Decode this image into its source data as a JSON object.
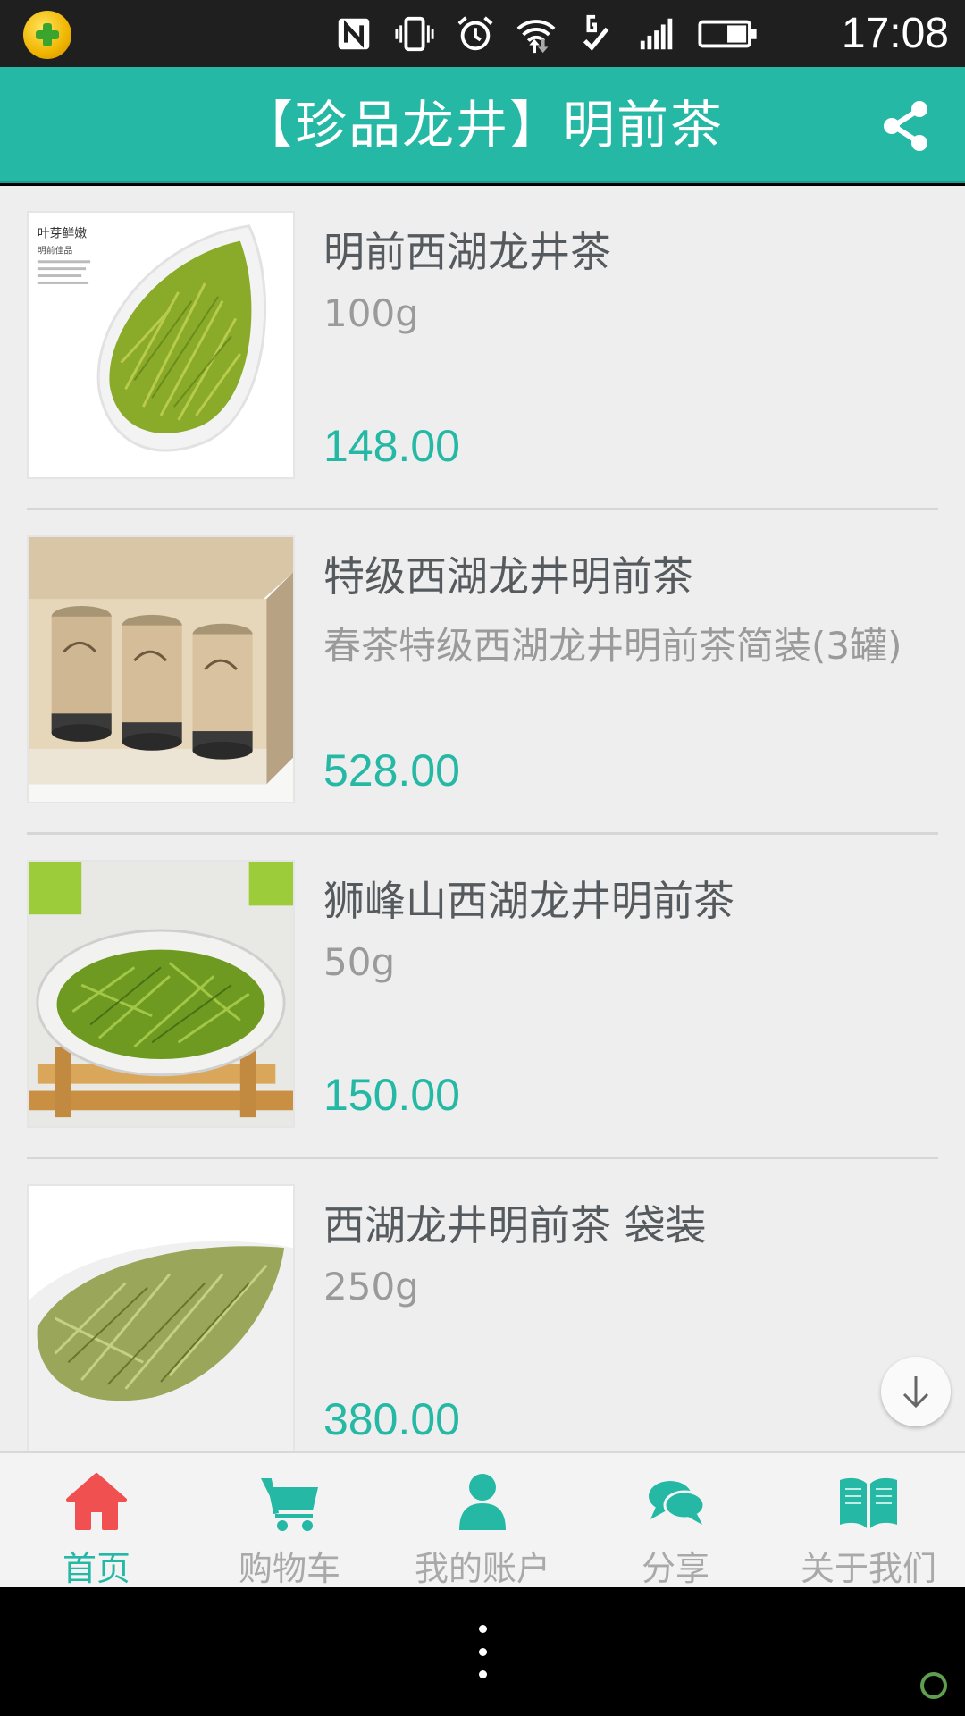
{
  "status_bar": {
    "time": "17:08",
    "icons": [
      "app-360-icon",
      "nfc-icon",
      "vibrate-icon",
      "alarm-icon",
      "wifi-icon",
      "data-g-icon",
      "signal-icon",
      "battery-icon"
    ]
  },
  "header": {
    "title": "【珍品龙井】明前茶",
    "share_icon": "share-icon"
  },
  "products": [
    {
      "name": "明前西湖龙井茶",
      "spec": "100g",
      "price": "148.00"
    },
    {
      "name": "特级西湖龙井明前茶",
      "spec": "春茶特级西湖龙井明前茶简装(3罐)",
      "price": "528.00"
    },
    {
      "name": "狮峰山西湖龙井明前茶",
      "spec": "50g",
      "price": "150.00"
    },
    {
      "name": "西湖龙井明前茶 袋装",
      "spec": "250g",
      "price": "380.00"
    }
  ],
  "product1_image_text": {
    "title": "叶芽鲜嫩",
    "subtitle": "明前佳品"
  },
  "tabs": [
    {
      "label": "首页",
      "icon": "home-icon",
      "active": true
    },
    {
      "label": "购物车",
      "icon": "cart-icon",
      "active": false
    },
    {
      "label": "我的账户",
      "icon": "user-icon",
      "active": false
    },
    {
      "label": "分享",
      "icon": "chat-bubbles-icon",
      "active": false
    },
    {
      "label": "关于我们",
      "icon": "book-icon",
      "active": false
    }
  ],
  "colors": {
    "accent": "#25b9a5",
    "home_icon": "#f0504f",
    "inactive_text": "#a9a9a9"
  }
}
